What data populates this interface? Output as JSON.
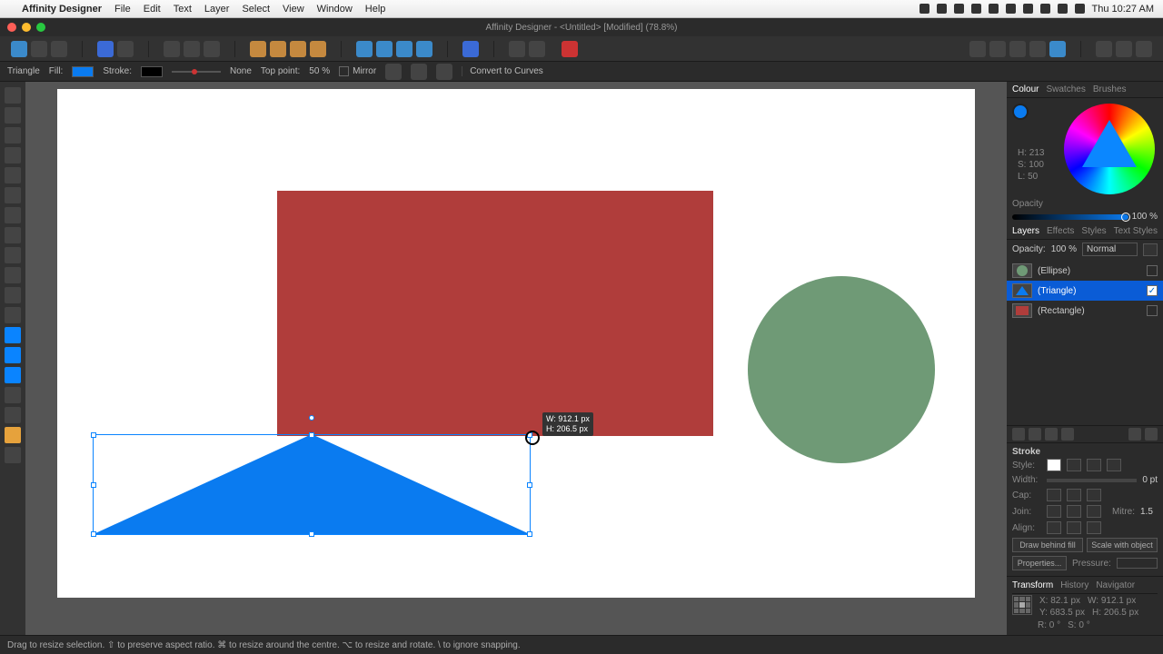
{
  "mac_menu": {
    "app": "Affinity Designer",
    "items": [
      "File",
      "Edit",
      "Text",
      "Layer",
      "Select",
      "View",
      "Window",
      "Help"
    ],
    "clock": "Thu 10:27 AM"
  },
  "window_title": "Affinity Designer - <Untitled> [Modified] (78.8%)",
  "context": {
    "shape": "Triangle",
    "fill_label": "Fill:",
    "stroke_label": "Stroke:",
    "none": "None",
    "top_point_label": "Top point:",
    "top_point_value": "50 %",
    "mirror": "Mirror",
    "convert": "Convert to Curves"
  },
  "size_tooltip": {
    "w": "W: 912.1 px",
    "h": "H: 206.5 px"
  },
  "color_tabs": [
    "Colour",
    "Swatches",
    "Brushes"
  ],
  "hsl": {
    "h": "H: 213",
    "s": "S: 100",
    "l": "L: 50",
    "opacity_label": "Opacity",
    "opacity_value": "100 %"
  },
  "layer_tabs": [
    "Layers",
    "Effects",
    "Styles",
    "Text Styles"
  ],
  "layer_opacity": {
    "label": "Opacity:",
    "value": "100 %",
    "blend": "Normal"
  },
  "layers": [
    {
      "name": "(Ellipse)",
      "color": "#6f9a76",
      "shape": "circle",
      "checked": false
    },
    {
      "name": "(Triangle)",
      "color": "#0a7bf0",
      "shape": "tri",
      "checked": true,
      "selected": true
    },
    {
      "name": "(Rectangle)",
      "color": "#b03d3b",
      "shape": "rect",
      "checked": false
    }
  ],
  "stroke": {
    "title": "Stroke",
    "style": "Style:",
    "width": "Width:",
    "width_val": "0 pt",
    "cap": "Cap:",
    "join": "Join:",
    "mitre": "Mitre:",
    "mitre_val": "1.5",
    "align": "Align:",
    "draw_behind": "Draw behind fill",
    "scale": "Scale with object",
    "properties": "Properties...",
    "pressure": "Pressure:"
  },
  "transform": {
    "tabs": [
      "Transform",
      "History",
      "Navigator"
    ],
    "x": "X: 82.1 px",
    "w": "W: 912.1 px",
    "y": "Y: 683.5 px",
    "h": "H: 206.5 px",
    "r": "R: 0 °",
    "s": "S: 0 °"
  },
  "status": "Drag to resize selection. ⇧ to preserve aspect ratio. ⌘ to resize around the centre. ⌥ to resize and rotate. \\ to ignore snapping.",
  "colors": {
    "blue": "#0a7bf0",
    "red": "#b03d3b",
    "green": "#6f9a76",
    "accent": "#0a84ff"
  }
}
